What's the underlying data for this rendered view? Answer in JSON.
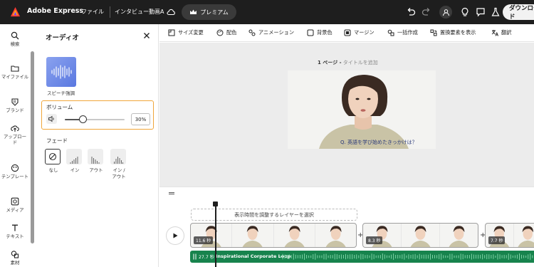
{
  "app": {
    "brand": "Adobe Express",
    "file_menu": "ファイル",
    "document_title": "インタビュー動画A",
    "premium_label": "プレミアム",
    "download_label": "ダウンロード"
  },
  "rail": {
    "items": [
      {
        "label": "検索",
        "icon": "search-icon"
      },
      {
        "label": "マイファイル",
        "icon": "folder-icon"
      },
      {
        "label": "ブランド",
        "icon": "brand-icon"
      },
      {
        "label": "アップロード",
        "icon": "upload-icon"
      },
      {
        "label": "テンプレート",
        "icon": "template-icon"
      },
      {
        "label": "メディア",
        "icon": "media-icon"
      },
      {
        "label": "テキスト",
        "icon": "text-icon"
      },
      {
        "label": "素材",
        "icon": "elements-icon"
      }
    ]
  },
  "panel": {
    "title": "オーディオ",
    "speech_enhance_label": "スピーチ強調",
    "volume_label": "ボリューム",
    "volume_value": "30%",
    "volume_fraction": 0.3,
    "fade_label": "フェード",
    "fade_options": [
      {
        "label": "なし",
        "selected": true
      },
      {
        "label": "イン",
        "selected": false
      },
      {
        "label": "アウト",
        "selected": false
      },
      {
        "label": "イン /\nアウト",
        "selected": false
      }
    ]
  },
  "toolbar": {
    "items": [
      {
        "label": "サイズ変更",
        "icon": "resize-icon"
      },
      {
        "label": "配色",
        "icon": "palette-icon"
      },
      {
        "label": "アニメーション",
        "icon": "animation-icon"
      },
      {
        "label": "背景色",
        "icon": "background-color-icon"
      },
      {
        "label": "マージン",
        "icon": "margin-icon"
      },
      {
        "label": "一括作成",
        "icon": "bulk-create-icon"
      },
      {
        "label": "置換要素を表示",
        "icon": "replace-elements-icon"
      },
      {
        "label": "翻訳",
        "icon": "translate-icon"
      }
    ]
  },
  "canvas": {
    "page_number": "1 ページ -",
    "add_title": "タイトルを追加",
    "subtitle": "Q. 英語を学び始めたきっかけは？"
  },
  "timeline": {
    "layer_hint": "表示時間を調整するレイヤーを選択",
    "clips": [
      {
        "duration": "11.6 秒"
      },
      {
        "duration": "8.3 秒"
      },
      {
        "duration": "7.7 秒"
      }
    ],
    "audio": {
      "duration": "27.7 秒",
      "name": "Inspirational Corporate Loop"
    }
  },
  "colors": {
    "topbar": "#1e1e1e",
    "accent_orange": "#f0a63a",
    "audio_green": "#17834d",
    "canvas_bg": "#ececec"
  }
}
